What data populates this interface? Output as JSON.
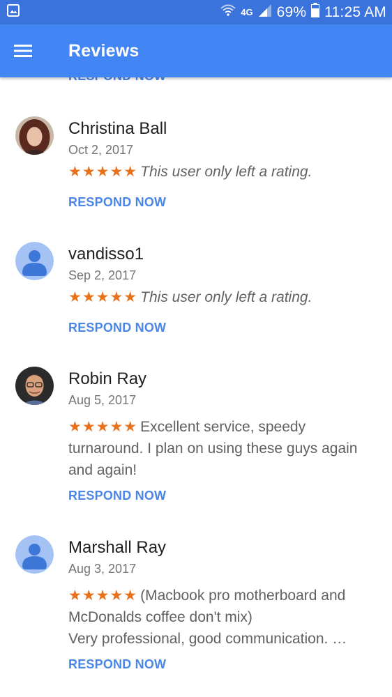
{
  "status_bar": {
    "network": "4G",
    "battery": "69%",
    "time": "11:25 AM",
    "icons": [
      "image-icon",
      "wifi-icon",
      "signal-icon",
      "battery-icon"
    ]
  },
  "app_bar": {
    "title": "Reviews",
    "menu_icon": "hamburger-menu-icon",
    "background": "#4285f4"
  },
  "respond_label": "RESPOND NOW",
  "colors": {
    "accent": "#4a86e8",
    "stars": "#e8711c",
    "avatar_default_bg": "#a4c2f4",
    "avatar_default_fg": "#3d78d8"
  },
  "reviews": [
    {
      "name": "Christina Ball",
      "date": "Oct 2, 2017",
      "stars": "★★★★★",
      "rating": 5,
      "text": "This user only left a rating.",
      "avatar": "photo",
      "respond": "RESPOND NOW"
    },
    {
      "name": "vandisso1",
      "date": "Sep 2, 2017",
      "stars": "★★★★★",
      "rating": 5,
      "text": "This user only left a rating.",
      "avatar": "default-person",
      "respond": "RESPOND NOW"
    },
    {
      "name": "Robin Ray",
      "date": "Aug 5, 2017",
      "stars": "★★★★★",
      "rating": 5,
      "text": "Excellent service, speedy turnaround. I plan on using these guys again and again!",
      "avatar": "photo",
      "respond": "RESPOND NOW"
    },
    {
      "name": "Marshall Ray",
      "date": "Aug 3, 2017",
      "stars": "★★★★★",
      "rating": 5,
      "text": "(Macbook pro motherboard and McDonalds coffee don't mix)",
      "text2": "Very professional, good communication. …",
      "avatar": "default-person",
      "respond": "RESPOND NOW"
    }
  ]
}
